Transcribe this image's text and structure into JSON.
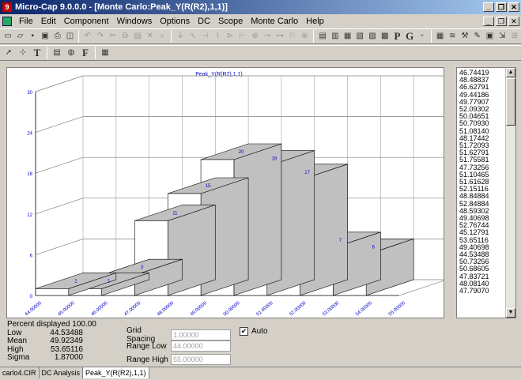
{
  "window": {
    "title": "Micro-Cap 9.0.0.0 - [Monte Carlo:Peak_Y(R(R2),1,1)]",
    "app_icon": "microcap-icon"
  },
  "menu": [
    "File",
    "Edit",
    "Component",
    "Windows",
    "Options",
    "DC",
    "Scope",
    "Monte Carlo",
    "Help"
  ],
  "toolbar1_icons": [
    "new-icon",
    "open-icon",
    "save-icon",
    "save-all-icon",
    "print-icon",
    "print-preview-icon",
    "undo-icon",
    "redo-icon",
    "cut-icon",
    "copy-icon",
    "paste-icon",
    "delete-icon",
    "find-icon",
    "resistor-icon",
    "capacitor-icon",
    "inductor-icon",
    "diode-icon",
    "ground-icon",
    "transistor-icon",
    "source-icon",
    "wire-icon",
    "bus-icon",
    "flag-icon",
    "probe-icon",
    "layout-icon",
    "window-icon",
    "grid-icon",
    "plot-icon",
    "text-icon",
    "table-icon",
    "p-icon",
    "g-icon",
    "label-icon",
    "tile-icon",
    "mesh-icon",
    "tools-icon",
    "pencil-icon",
    "image-icon",
    "scale-icon",
    "zoom-icon"
  ],
  "toolbar2_icons": [
    "pointer-icon",
    "select-icon",
    "text-tool-icon",
    "properties-icon",
    "palette-icon",
    "font-icon",
    "grid-toggle-icon"
  ],
  "toolbar2_labels": {
    "text_tool": "T",
    "font": "F"
  },
  "chart_data": {
    "type": "bar",
    "title": "Peak_Y(R(R2),1,1)",
    "categories": [
      "44.00000",
      "45.00000",
      "46.00000",
      "47.00000",
      "48.00000",
      "49.00000",
      "50.00000",
      "51.00000",
      "52.00000",
      "53.00000",
      "54.00000",
      "55.00000"
    ],
    "values": [
      1,
      1,
      3,
      11,
      15,
      20,
      19,
      17,
      7,
      6
    ],
    "value_labels": [
      "1",
      "1",
      "3",
      "11",
      "15",
      "20",
      "19",
      "17",
      "7",
      "6"
    ],
    "bins": [
      [
        44,
        45
      ],
      [
        45,
        46
      ],
      [
        46,
        47
      ],
      [
        47,
        48
      ],
      [
        48,
        49
      ],
      [
        49,
        50
      ],
      [
        50,
        51
      ],
      [
        51,
        52
      ],
      [
        52,
        53
      ],
      [
        53,
        54
      ]
    ],
    "ylim": [
      0,
      30
    ],
    "yticks": [
      "0",
      "6",
      "12",
      "18",
      "24",
      "30"
    ],
    "grid": true,
    "bar_fill": "#ffffff",
    "bar_shade": "#c0c0c0",
    "label_color": "#0000cc"
  },
  "values_list": [
    "46.74419",
    "48.48837",
    "46.62791",
    "49.44186",
    "49.77907",
    "52.09302",
    "50.04651",
    "50.70930",
    "51.08140",
    "48.17442",
    "51.72093",
    "51.62791",
    "51.75581",
    "47.73256",
    "51.10465",
    "51.61628",
    "52.15116",
    "48.84884",
    "52.84884",
    "48.59302",
    "49.40698",
    "52.76744",
    "45.12791",
    "53.65116",
    "49.40698",
    "44.53488",
    "50.73256",
    "50.68605",
    "47.83721",
    "48.08140",
    "47.79070"
  ],
  "stats": {
    "percent_label": "Percent displayed",
    "percent_value": "100.00",
    "low_label": "Low",
    "low_value": "44.53488",
    "mean_label": "Mean",
    "mean_value": "49.92349",
    "high_label": "High",
    "high_value": "53.65116",
    "sigma_label": "Sigma",
    "sigma_value": "1.87000"
  },
  "controls": {
    "grid_spacing_label": "Grid Spacing",
    "grid_spacing_value": "1.00000",
    "range_low_label": "Range Low",
    "range_low_value": "44.00000",
    "range_high_label": "Range High",
    "range_high_value": "55.00000",
    "auto_label": "Auto",
    "auto_checked": true,
    "check_mark": "✔"
  },
  "tabs": [
    "carlo4.CIR",
    "DC Analysis",
    "Peak_Y(R(R2),1,1)"
  ]
}
